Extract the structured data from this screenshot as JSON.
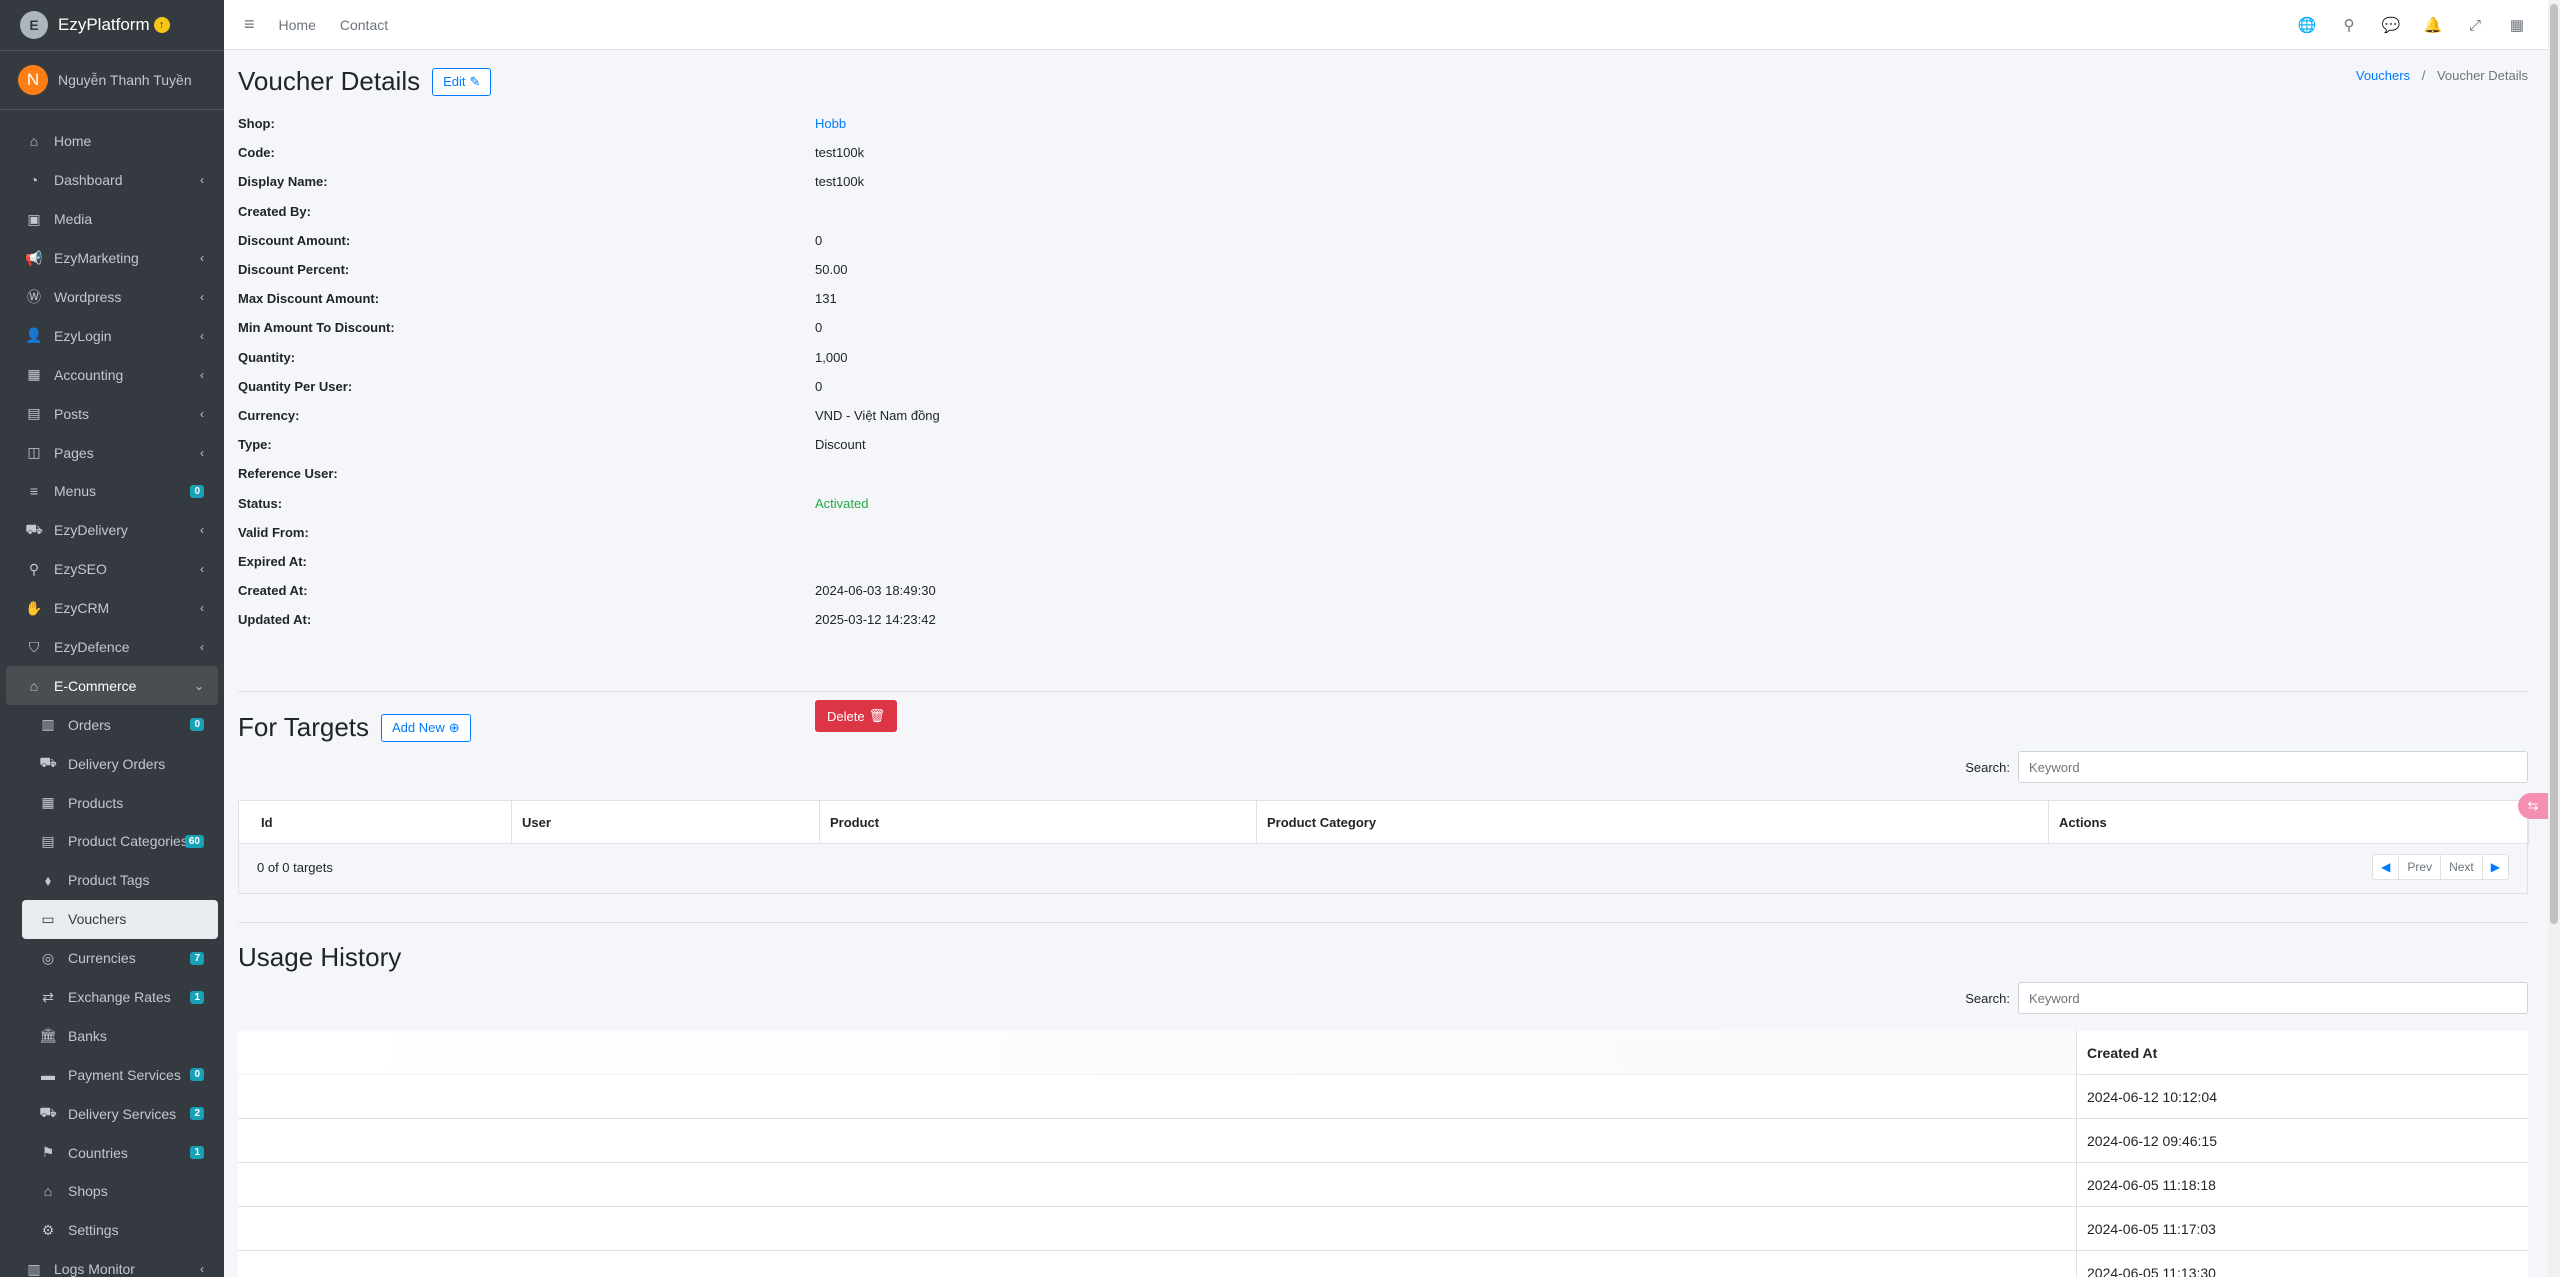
{
  "brand": {
    "name": "EzyPlatform",
    "logo_letter": "E",
    "badge": "↑"
  },
  "user": {
    "initial": "N",
    "name": "Nguyễn Thanh Tuyền"
  },
  "sidebar": {
    "items": [
      {
        "label": "Home",
        "icon": "home-icon",
        "glyph": "⌂"
      },
      {
        "label": "Dashboard",
        "icon": "dashboard-icon",
        "glyph": "◔",
        "chevron": "‹"
      },
      {
        "label": "Media",
        "icon": "image-icon",
        "glyph": "▣"
      },
      {
        "label": "EzyMarketing",
        "icon": "megaphone-icon",
        "glyph": "📢",
        "chevron": "‹"
      },
      {
        "label": "Wordpress",
        "icon": "wordpress-icon",
        "glyph": "Ⓦ",
        "chevron": "‹"
      },
      {
        "label": "EzyLogin",
        "icon": "user-lock-icon",
        "glyph": "👤",
        "chevron": "‹"
      },
      {
        "label": "Accounting",
        "icon": "calculator-icon",
        "glyph": "▦",
        "chevron": "‹"
      },
      {
        "label": "Posts",
        "icon": "posts-icon",
        "glyph": "▤",
        "chevron": "‹"
      },
      {
        "label": "Pages",
        "icon": "pages-icon",
        "glyph": "◫",
        "chevron": "‹"
      },
      {
        "label": "Menus",
        "icon": "bars-icon",
        "glyph": "≡",
        "badge": "0"
      },
      {
        "label": "EzyDelivery",
        "icon": "truck-icon",
        "glyph": "⛟",
        "chevron": "‹"
      },
      {
        "label": "EzySEO",
        "icon": "search-icon",
        "glyph": "⚲",
        "chevron": "‹"
      },
      {
        "label": "EzyCRM",
        "icon": "handshake-icon",
        "glyph": "✋",
        "chevron": "‹"
      },
      {
        "label": "EzyDefence",
        "icon": "shield-icon",
        "glyph": "⛉",
        "chevron": "‹"
      }
    ],
    "ecommerce": {
      "label": "E-Commerce",
      "icon": "basket-icon",
      "glyph": "⌂",
      "chevron": "⌄"
    },
    "sub_items": [
      {
        "label": "Orders",
        "icon": "orders-icon",
        "glyph": "▥",
        "badge": "0"
      },
      {
        "label": "Delivery Orders",
        "icon": "delivery-orders-icon",
        "glyph": "⛟"
      },
      {
        "label": "Products",
        "icon": "boxes-icon",
        "glyph": "▦"
      },
      {
        "label": "Product Categories",
        "icon": "clipboard-icon",
        "glyph": "▤",
        "badge": "60"
      },
      {
        "label": "Product Tags",
        "icon": "tags-icon",
        "glyph": "⬧"
      },
      {
        "label": "Vouchers",
        "icon": "ticket-icon",
        "glyph": "▭",
        "active": true
      },
      {
        "label": "Currencies",
        "icon": "coins-icon",
        "glyph": "◎",
        "badge": "7"
      },
      {
        "label": "Exchange Rates",
        "icon": "exchange-icon",
        "glyph": "⇄",
        "badge": "1"
      },
      {
        "label": "Banks",
        "icon": "bank-icon",
        "glyph": "🏛"
      },
      {
        "label": "Payment Services",
        "icon": "credit-card-icon",
        "glyph": "▬",
        "badge": "0"
      },
      {
        "label": "Delivery Services",
        "icon": "shipping-icon",
        "glyph": "⛟",
        "badge": "2"
      },
      {
        "label": "Countries",
        "icon": "flag-icon",
        "glyph": "⚑",
        "badge": "1"
      },
      {
        "label": "Shops",
        "icon": "store-icon",
        "glyph": "⌂"
      },
      {
        "label": "Settings",
        "icon": "gear-icon",
        "glyph": "⚙"
      }
    ],
    "logs": {
      "label": "Logs Monitor",
      "icon": "logs-icon",
      "glyph": "▥",
      "chevron": "‹"
    }
  },
  "topbar": {
    "menu_glyph": "≡",
    "links": [
      "Home",
      "Contact"
    ],
    "icons": [
      {
        "name": "globe-icon",
        "glyph": "🌐"
      },
      {
        "name": "search-icon",
        "glyph": "⚲"
      },
      {
        "name": "comments-icon",
        "glyph": "💬"
      },
      {
        "name": "bell-icon",
        "glyph": "🔔"
      },
      {
        "name": "expand-icon",
        "glyph": "⤢"
      },
      {
        "name": "apps-grid-icon",
        "glyph": "▦"
      }
    ]
  },
  "page": {
    "title": "Voucher Details",
    "edit_label": "Edit",
    "breadcrumb": {
      "parent": "Vouchers",
      "current": "Voucher Details",
      "sep": "/"
    }
  },
  "details": [
    {
      "label": "Shop:",
      "value": "Hobb",
      "kind": "link"
    },
    {
      "label": "Code:",
      "value": "test100k"
    },
    {
      "label": "Display Name:",
      "value": "test100k"
    },
    {
      "label": "Created By:",
      "value": ""
    },
    {
      "label": "Discount Amount:",
      "value": "0"
    },
    {
      "label": "Discount Percent:",
      "value": "50.00"
    },
    {
      "label": "Max Discount Amount:",
      "value": "131"
    },
    {
      "label": "Min Amount To Discount:",
      "value": "0"
    },
    {
      "label": "Quantity:",
      "value": "1,000"
    },
    {
      "label": "Quantity Per User:",
      "value": "0"
    },
    {
      "label": "Currency:",
      "value": "VND - Việt Nam đồng"
    },
    {
      "label": "Type:",
      "value": "Discount"
    },
    {
      "label": "Reference User:",
      "value": ""
    },
    {
      "label": "Status:",
      "value": "Activated",
      "kind": "ok"
    },
    {
      "label": "Valid From:",
      "value": ""
    },
    {
      "label": "Expired At:",
      "value": ""
    },
    {
      "label": "Created At:",
      "value": "2024-06-03 18:49:30"
    },
    {
      "label": "Updated At:",
      "value": "2025-03-12 14:23:42"
    }
  ],
  "delete_label": "Delete",
  "targets": {
    "title": "For Targets",
    "add_label": "Add New",
    "search_label": "Search:",
    "search_placeholder": "Keyword",
    "columns": [
      "Id",
      "User",
      "Product",
      "Product Category",
      "Actions"
    ],
    "footer_text": "0 of 0 targets",
    "pager": {
      "prev": "Prev",
      "next": "Next"
    }
  },
  "usage": {
    "title": "Usage History",
    "search_label": "Search:",
    "search_placeholder": "Keyword",
    "created_header": "Created At",
    "created_values": [
      "2024-06-12 10:12:04",
      "2024-06-12 09:46:15",
      "2024-06-05 11:18:18",
      "2024-06-05 11:17:03",
      "2024-06-05 11:13:30"
    ]
  }
}
